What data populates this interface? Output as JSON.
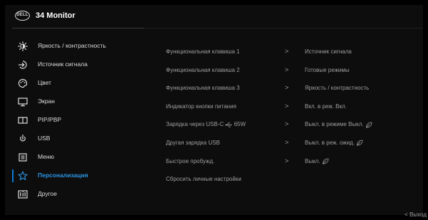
{
  "header": {
    "logo_text": "DELL",
    "title": "34 Monitor"
  },
  "sidebar": {
    "items": [
      {
        "label": "Яркость / контрастность",
        "icon": "brightness-icon"
      },
      {
        "label": "Источник сигнала",
        "icon": "input-source-icon"
      },
      {
        "label": "Цвет",
        "icon": "palette-icon"
      },
      {
        "label": "Экран",
        "icon": "display-icon"
      },
      {
        "label": "PIP/PBP",
        "icon": "pip-pbp-icon"
      },
      {
        "label": "USB",
        "icon": "usb-icon"
      },
      {
        "label": "Меню",
        "icon": "menu-icon"
      },
      {
        "label": "Персонализация",
        "icon": "star-icon"
      },
      {
        "label": "Другое",
        "icon": "info-icon"
      }
    ],
    "selected": "Персонализация"
  },
  "settings": {
    "rows": [
      {
        "label": "Функциональная клавиша 1",
        "value": "Источник сигнала"
      },
      {
        "label": "Функциональная клавиша 2",
        "value": "Готовые режимы"
      },
      {
        "label": "Функциональная клавиша 3",
        "value": "Яркость / контрастность"
      },
      {
        "label": "Индикатор кнопки питания",
        "value": "Вкл. в реж. Вкл."
      },
      {
        "label": "Зарядка через USB-C",
        "label_suffix": "65W",
        "value": "Выкл. в режиме Выкл."
      },
      {
        "label": "Другая зарядка USB",
        "value": "Выкл. в реж. ожид."
      },
      {
        "label": "Быстрое пробужд.",
        "value": "Выкл."
      },
      {
        "label": "Сбросить личные настройки",
        "value": ""
      }
    ],
    "arrow": ">"
  },
  "footer": {
    "exit_label": "Выход"
  },
  "colors": {
    "accent": "#2b95e6",
    "selection_bar": "#0a78d4",
    "background": "#0d0d0d"
  }
}
